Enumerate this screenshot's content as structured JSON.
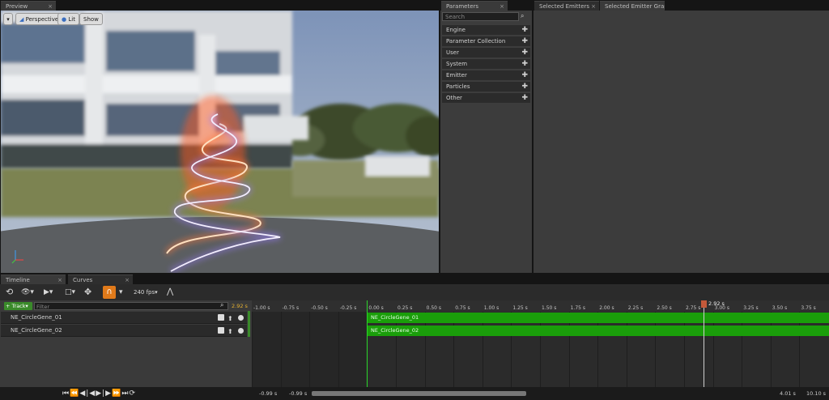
{
  "tabs": {
    "preview": "Preview",
    "parameters": "Parameters",
    "selected_emitters": "Selected Emitters",
    "selected_emitter_graph": "Selected Emitter Graph",
    "timeline": "Timeline",
    "curves": "Curves"
  },
  "viewport": {
    "perspective": "Perspective",
    "lit": "Lit",
    "show": "Show"
  },
  "parameters": {
    "search_placeholder": "Search",
    "categories": [
      "Engine",
      "Parameter Collection",
      "User",
      "System",
      "Emitter",
      "Particles",
      "Other"
    ]
  },
  "timeline": {
    "fps": "240 fps",
    "add_track": "+ Track",
    "filter_placeholder": "Filter",
    "current_time": "2.92 s",
    "playhead_label": "2.92 s",
    "ticks": [
      "-1.00 s",
      "-0.75 s",
      "-0.50 s",
      "-0.25 s",
      "0.00 s",
      "0.25 s",
      "0.50 s",
      "0.75 s",
      "1.00 s",
      "1.25 s",
      "1.50 s",
      "1.75 s",
      "2.00 s",
      "2.25 s",
      "2.50 s",
      "2.75 s",
      "3.00 s",
      "3.25 s",
      "3.50 s",
      "3.75 s"
    ],
    "tracks": [
      "NE_CircleGene_01",
      "NE_CircleGene_02"
    ],
    "view_start": "-0.99 s",
    "view_start2": "-0.99 s",
    "view_end": "4.01 s",
    "range_end": "10.10 s"
  },
  "colors": {
    "track_green": "#1a9e0a",
    "playhead": "#c3593a",
    "snap_orange": "#e07a1a"
  }
}
